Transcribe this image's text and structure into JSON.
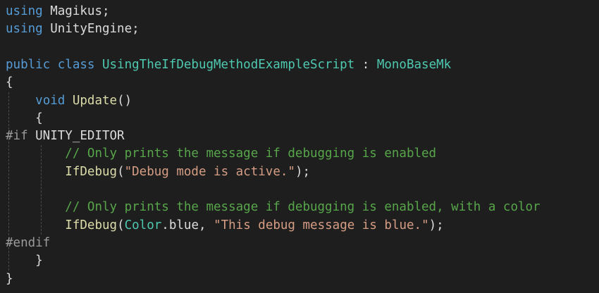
{
  "editor": {
    "lines": [
      {
        "tokens": [
          {
            "k": "kw",
            "t": "using"
          },
          {
            "k": "id",
            "t": " Magikus"
          },
          {
            "k": "pun",
            "t": ";"
          }
        ]
      },
      {
        "tokens": [
          {
            "k": "kw",
            "t": "using"
          },
          {
            "k": "id",
            "t": " UnityEngine"
          },
          {
            "k": "pun",
            "t": ";"
          }
        ]
      },
      {
        "tokens": []
      },
      {
        "tokens": [
          {
            "k": "kw",
            "t": "public"
          },
          {
            "k": "kw",
            "t": " class"
          },
          {
            "k": "type",
            "t": " UsingTheIfDebugMethodExampleScript"
          },
          {
            "k": "pun",
            "t": " : "
          },
          {
            "k": "type",
            "t": "MonoBaseMk"
          }
        ]
      },
      {
        "tokens": [
          {
            "k": "pun",
            "t": "{"
          }
        ]
      },
      {
        "tokens": [
          {
            "k": "id",
            "t": "    "
          },
          {
            "k": "kw",
            "t": "void"
          },
          {
            "k": "id",
            "t": " "
          },
          {
            "k": "fn",
            "t": "Update"
          },
          {
            "k": "pun",
            "t": "()"
          }
        ]
      },
      {
        "tokens": [
          {
            "k": "id",
            "t": "    "
          },
          {
            "k": "pun",
            "t": "{"
          }
        ]
      },
      {
        "tokens": [
          {
            "k": "pp",
            "t": "#if"
          },
          {
            "k": "id",
            "t": " UNITY_EDITOR"
          }
        ]
      },
      {
        "tokens": [
          {
            "k": "id",
            "t": "        "
          },
          {
            "k": "cmt",
            "t": "// Only prints the message if debugging is enabled"
          }
        ]
      },
      {
        "tokens": [
          {
            "k": "id",
            "t": "        "
          },
          {
            "k": "fn",
            "t": "IfDebug"
          },
          {
            "k": "pun",
            "t": "("
          },
          {
            "k": "str",
            "t": "\"Debug mode is active.\""
          },
          {
            "k": "pun",
            "t": ");"
          }
        ]
      },
      {
        "tokens": []
      },
      {
        "tokens": [
          {
            "k": "id",
            "t": "        "
          },
          {
            "k": "cmt",
            "t": "// Only prints the message if debugging is enabled, with a color"
          }
        ]
      },
      {
        "tokens": [
          {
            "k": "id",
            "t": "        "
          },
          {
            "k": "fn",
            "t": "IfDebug"
          },
          {
            "k": "pun",
            "t": "("
          },
          {
            "k": "type",
            "t": "Color"
          },
          {
            "k": "pun",
            "t": "."
          },
          {
            "k": "id",
            "t": "blue"
          },
          {
            "k": "pun",
            "t": ", "
          },
          {
            "k": "str",
            "t": "\"This debug message is blue.\""
          },
          {
            "k": "pun",
            "t": ");"
          }
        ]
      },
      {
        "tokens": [
          {
            "k": "pp",
            "t": "#endif"
          }
        ]
      },
      {
        "tokens": [
          {
            "k": "id",
            "t": "    "
          },
          {
            "k": "pun",
            "t": "}"
          }
        ]
      },
      {
        "tokens": [
          {
            "k": "pun",
            "t": "}"
          }
        ]
      }
    ]
  }
}
